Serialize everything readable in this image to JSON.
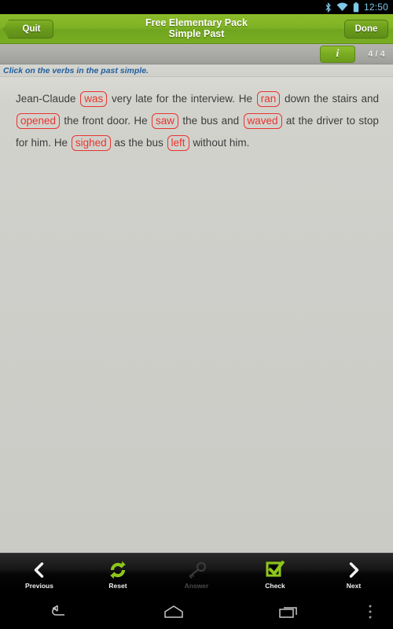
{
  "statusbar": {
    "time": "12:50",
    "icons": [
      "bluetooth-icon",
      "wifi-icon",
      "battery-icon"
    ]
  },
  "header": {
    "quit_label": "Quit",
    "done_label": "Done",
    "title_line1": "Free Elementary Pack",
    "title_line2": "Simple Past"
  },
  "subbar": {
    "info_label": "i",
    "counter": "4 / 4"
  },
  "instruction": {
    "text": "Click on the verbs in the past simple."
  },
  "exercise": {
    "tokens": [
      {
        "text": "Jean-Claude",
        "verb": false
      },
      {
        "text": "was",
        "verb": true
      },
      {
        "text": "very",
        "verb": false
      },
      {
        "text": "late",
        "verb": false
      },
      {
        "text": "for",
        "verb": false
      },
      {
        "text": "the",
        "verb": false
      },
      {
        "text": "interview.",
        "verb": false
      },
      {
        "text": "He",
        "verb": false
      },
      {
        "text": "ran",
        "verb": true
      },
      {
        "text": "down",
        "verb": false
      },
      {
        "text": "the",
        "verb": false
      },
      {
        "text": "stairs",
        "verb": false
      },
      {
        "text": "and",
        "verb": false
      },
      {
        "text": "opened",
        "verb": true
      },
      {
        "text": "the",
        "verb": false
      },
      {
        "text": "front",
        "verb": false
      },
      {
        "text": "door.",
        "verb": false
      },
      {
        "text": "He",
        "verb": false
      },
      {
        "text": "saw",
        "verb": true
      },
      {
        "text": "the",
        "verb": false
      },
      {
        "text": "bus",
        "verb": false
      },
      {
        "text": "and",
        "verb": false
      },
      {
        "text": "waved",
        "verb": true
      },
      {
        "text": "at",
        "verb": false
      },
      {
        "text": "the",
        "verb": false
      },
      {
        "text": "driver",
        "verb": false
      },
      {
        "text": "to",
        "verb": false
      },
      {
        "text": "stop",
        "verb": false
      },
      {
        "text": "for",
        "verb": false
      },
      {
        "text": "him.",
        "verb": false
      },
      {
        "text": "He",
        "verb": false
      },
      {
        "text": "sighed",
        "verb": true
      },
      {
        "text": "as",
        "verb": false
      },
      {
        "text": "the",
        "verb": false
      },
      {
        "text": "bus",
        "verb": false
      },
      {
        "text": "left",
        "verb": true
      },
      {
        "text": "without",
        "verb": false
      },
      {
        "text": "him.",
        "verb": false
      }
    ]
  },
  "toolbar": {
    "buttons": [
      {
        "label": "Previous",
        "icon": "chevron-left-icon",
        "enabled": true
      },
      {
        "label": "Reset",
        "icon": "refresh-icon",
        "enabled": true
      },
      {
        "label": "Answer",
        "icon": "key-icon",
        "enabled": false
      },
      {
        "label": "Check",
        "icon": "checkbox-check-icon",
        "enabled": true
      },
      {
        "label": "Next",
        "icon": "chevron-right-icon",
        "enabled": true
      }
    ]
  },
  "navbar": {
    "buttons": [
      "back-icon",
      "home-icon",
      "recents-icon",
      "overflow-menu-icon"
    ]
  },
  "colors": {
    "brand_green": "#7fb226",
    "verb_red": "#e8352e",
    "instruction_blue": "#1f5f9c",
    "content_bg": "#cececa",
    "status_blue": "#7fc8e8"
  }
}
